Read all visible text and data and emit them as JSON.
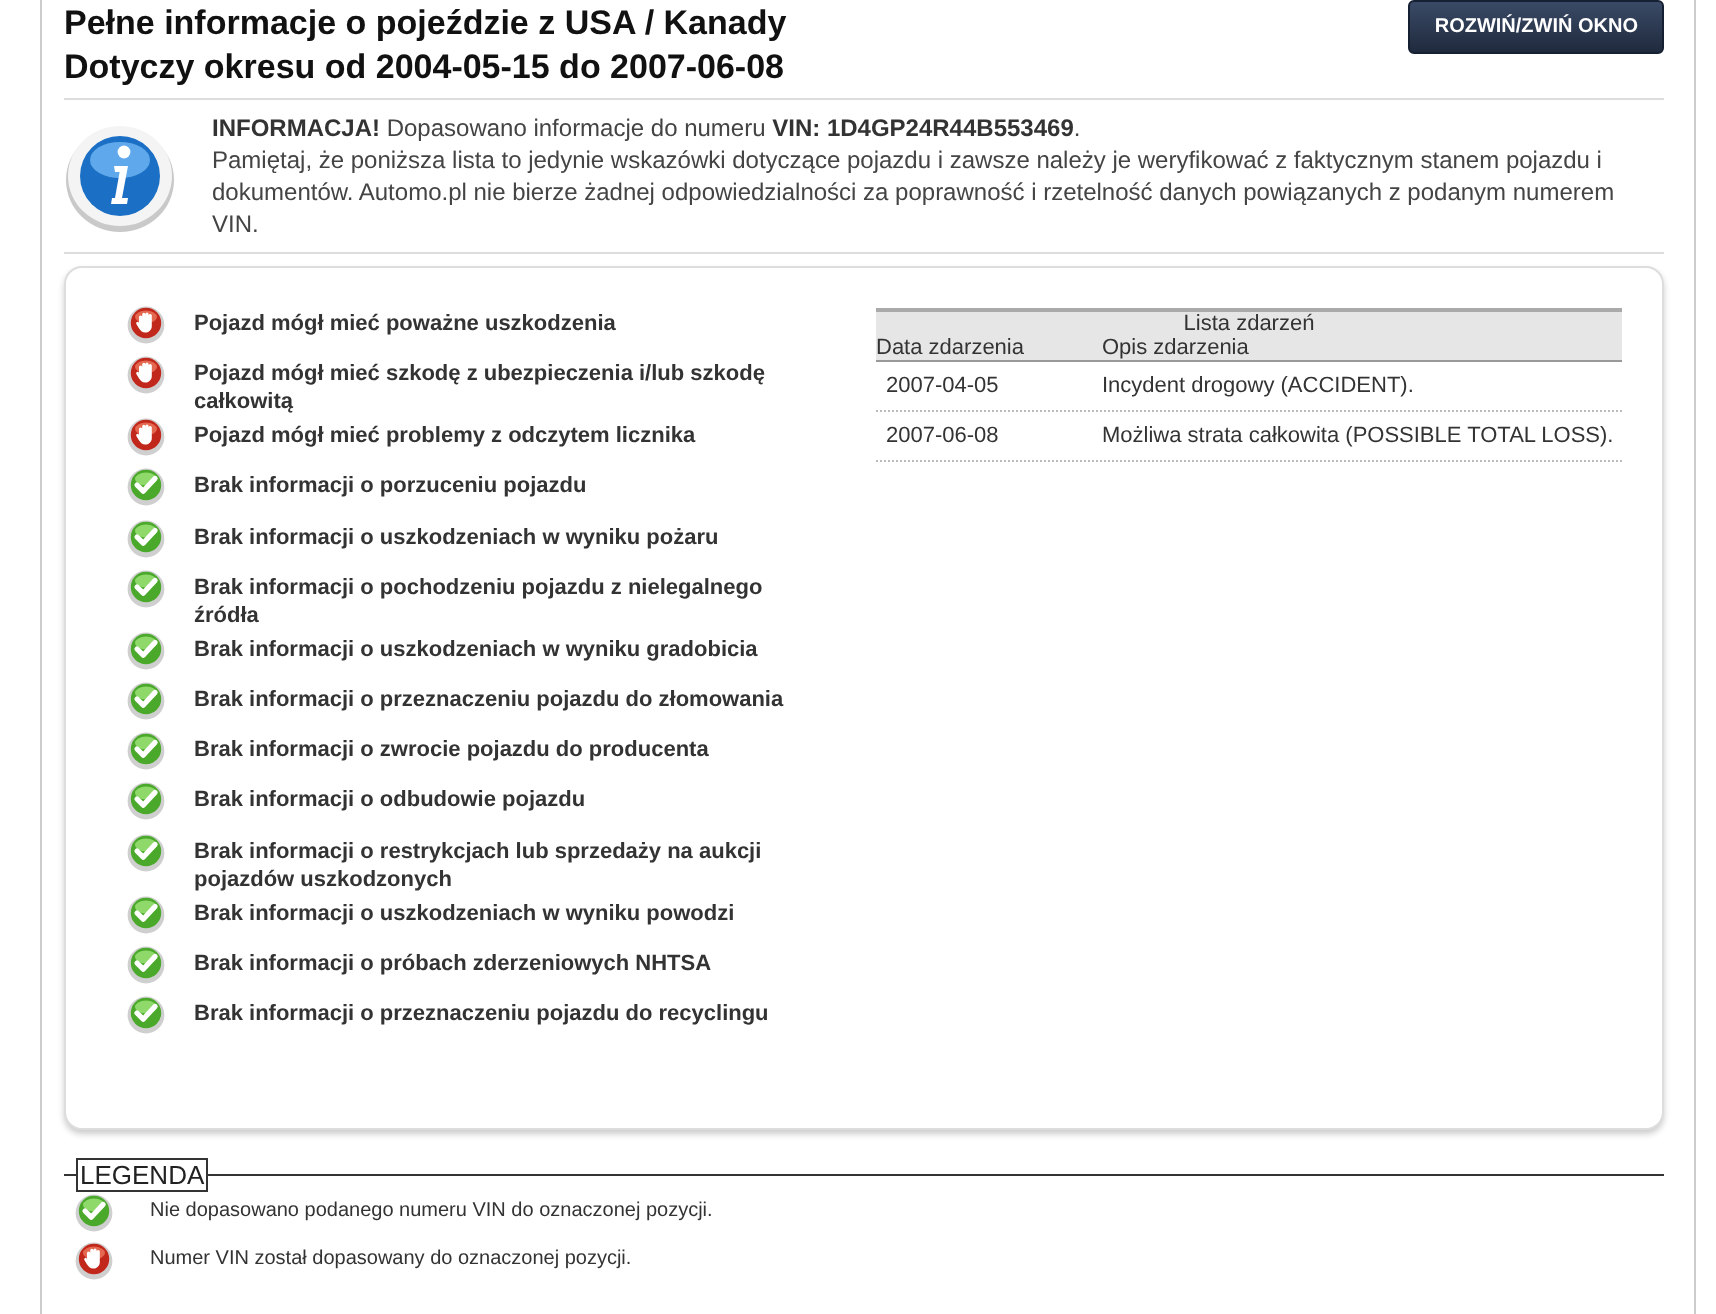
{
  "header": {
    "title": "Pełne informacje o pojeździe z USA / Kanady",
    "period": "Dotyczy okresu od 2004-05-15 do 2007-06-08",
    "toggle_button": "ROZWIŃ/ZWIŃ OKNO"
  },
  "info": {
    "text": "**INFORMACJA!** Dopasowano informacje do numeru **VIN: 1D4GP24R44B553469**.",
    "note": "Pamiętaj, że poniższa lista to jedynie wskazówki dotyczące pojazdu i zawsze należy je weryfikować z faktycznym stanem pojazdu i dokumentów. Automo.pl nie bierze żadnej odpowiedzialności za poprawność i rzetelność danych powiązanych z podanym numerem VIN."
  },
  "checks": [
    {
      "kind": "alert",
      "label": "Pojazd mógł mieć poważne uszkodzenia"
    },
    {
      "kind": "alert",
      "label": "Pojazd mógł mieć szkodę z ubezpieczenia i/lub szkodę całkowitą"
    },
    {
      "kind": "alert",
      "label": "Pojazd mógł mieć problemy z odczytem licznika"
    },
    {
      "kind": "ok",
      "label": "Brak informacji o porzuceniu pojazdu"
    },
    {
      "kind": "ok",
      "label": "Brak informacji o uszkodzeniach w wyniku pożaru"
    },
    {
      "kind": "ok",
      "label": "Brak informacji o pochodzeniu pojazdu z nielegalnego źródła"
    },
    {
      "kind": "ok",
      "label": "Brak informacji o uszkodzeniach w wyniku gradobicia"
    },
    {
      "kind": "ok",
      "label": "Brak informacji o przeznaczeniu pojazdu do złomowania"
    },
    {
      "kind": "ok",
      "label": "Brak informacji o zwrocie pojazdu do producenta"
    },
    {
      "kind": "ok",
      "label": "Brak informacji o odbudowie pojazdu"
    },
    {
      "kind": "ok",
      "label": "Brak informacji o restrykcjach lub sprzedaży na aukcji pojazdów uszkodzonych"
    },
    {
      "kind": "ok",
      "label": "Brak informacji o uszkodzeniach w wyniku powodzi"
    },
    {
      "kind": "ok",
      "label": "Brak informacji o próbach zderzeniowych NHTSA"
    },
    {
      "kind": "ok",
      "label": "Brak informacji o przeznaczeniu pojazdu do recyclingu"
    }
  ],
  "events": {
    "title": "Lista zdarzeń",
    "columns": [
      "Data zdarzenia",
      "Opis zdarzenia"
    ],
    "rows": [
      [
        "2007-04-05",
        "Incydent drogowy (ACCIDENT)."
      ],
      [
        "2007-06-08",
        "Możliwa strata całkowita (POSSIBLE TOTAL LOSS)."
      ]
    ]
  },
  "legend": {
    "title": "LEGENDA",
    "items": [
      {
        "kind": "ok",
        "label": "Nie dopasowano podanego numeru VIN do oznaczonej pozycji."
      },
      {
        "kind": "alert",
        "label": "Numer VIN został dopasowany do oznaczonej pozycji."
      }
    ]
  }
}
